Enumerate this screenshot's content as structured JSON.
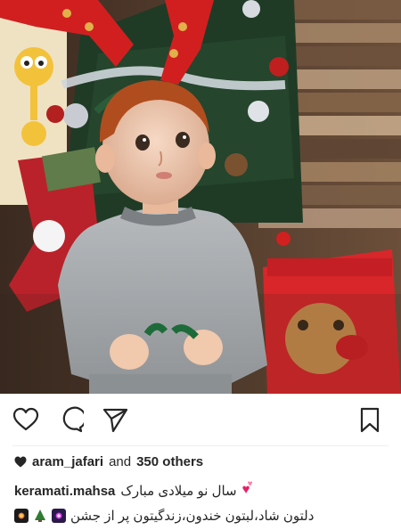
{
  "post": {
    "image_alt": "Toddler with reindeer antler headband in front of a Christmas tree"
  },
  "actions": {
    "like_icon": "heart-outline-icon",
    "comment_icon": "speech-bubble-icon",
    "share_icon": "paper-plane-icon",
    "save_icon": "bookmark-icon"
  },
  "likes": {
    "user": "aram_jafari",
    "and": "and",
    "others": "350 others"
  },
  "caption": {
    "author": "keramati.mahsa",
    "line1": "سال نو میلادی مبارک",
    "line2": "دلتون شاد،لبتون خندون،زندگیتون پر از جشن"
  },
  "colors": {
    "text": "#262626",
    "divider": "#efefef",
    "background": "#ffffff"
  }
}
